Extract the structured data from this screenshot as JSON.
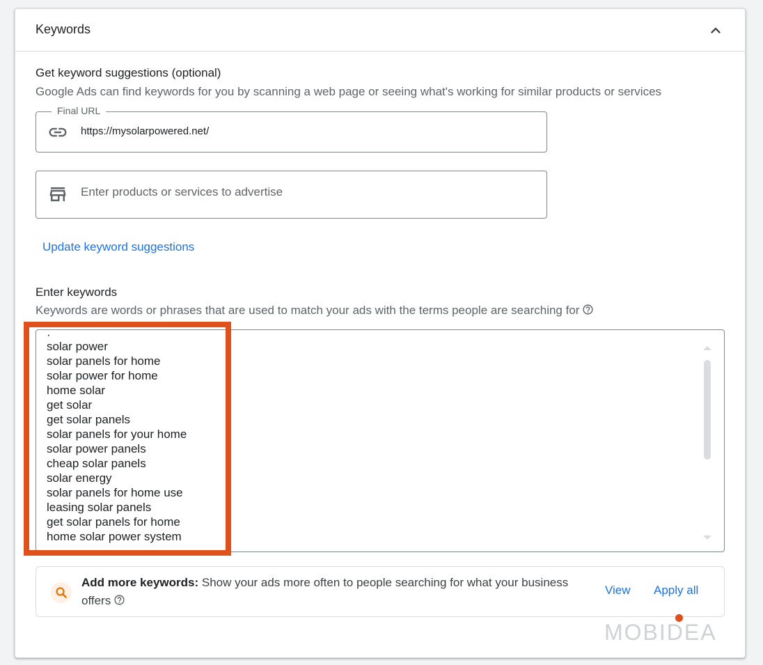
{
  "card": {
    "title": "Keywords"
  },
  "suggestions": {
    "title": "Get keyword suggestions (optional)",
    "subtitle": "Google Ads can find keywords for you by scanning a web page or seeing what's working for similar products or services",
    "final_url": {
      "label": "Final URL",
      "value": "https://mysolarpowered.net/"
    },
    "products": {
      "placeholder": "Enter products or services to advertise"
    },
    "update_link": "Update keyword suggestions"
  },
  "keywords": {
    "title": "Enter keywords",
    "subtitle": "Keywords are words or phrases that are used to match your ads with the terms people are searching for",
    "items": [
      "solar power",
      "solar panels for home",
      "solar power for home",
      "home solar",
      "get solar",
      "get solar panels",
      "solar panels for your home",
      "solar power panels",
      "cheap solar panels",
      "solar energy",
      "solar panels for home use",
      "leasing solar panels",
      "get solar panels for home",
      "home solar power system"
    ]
  },
  "add_more": {
    "bold": "Add more keywords:",
    "text": " Show your ads more often to people searching for what your business offers",
    "view": "View",
    "apply_all": "Apply all"
  },
  "watermark": {
    "text": "MOBIDEA"
  },
  "colors": {
    "accent": "#1a73e8",
    "highlight": "#e0501a",
    "search_icon": "#e37400"
  }
}
